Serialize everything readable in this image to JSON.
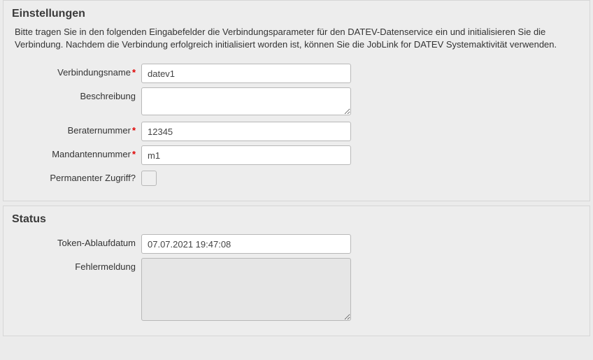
{
  "settings": {
    "heading": "Einstellungen",
    "intro": "Bitte tragen Sie in den folgenden Eingabefelder die Verbindungsparameter für den DATEV-Datenservice ein und initialisieren Sie die Verbindung. Nachdem die Verbindung erfolgreich initialisiert worden ist, können Sie die JobLink for DATEV Systemaktivität verwenden.",
    "fields": {
      "connection_name": {
        "label": "Verbindungsname",
        "value": "datev1",
        "required": true
      },
      "description": {
        "label": "Beschreibung",
        "value": "",
        "required": false
      },
      "advisor_number": {
        "label": "Beraternummer",
        "value": "12345",
        "required": true
      },
      "client_number": {
        "label": "Mandantennummer",
        "value": "m1",
        "required": true
      },
      "permanent_access": {
        "label": "Permanenter Zugriff?",
        "checked": false
      }
    }
  },
  "status": {
    "heading": "Status",
    "fields": {
      "token_expiry": {
        "label": "Token-Ablaufdatum",
        "value": "07.07.2021 19:47:08"
      },
      "error_message": {
        "label": "Fehlermeldung",
        "value": ""
      }
    }
  }
}
